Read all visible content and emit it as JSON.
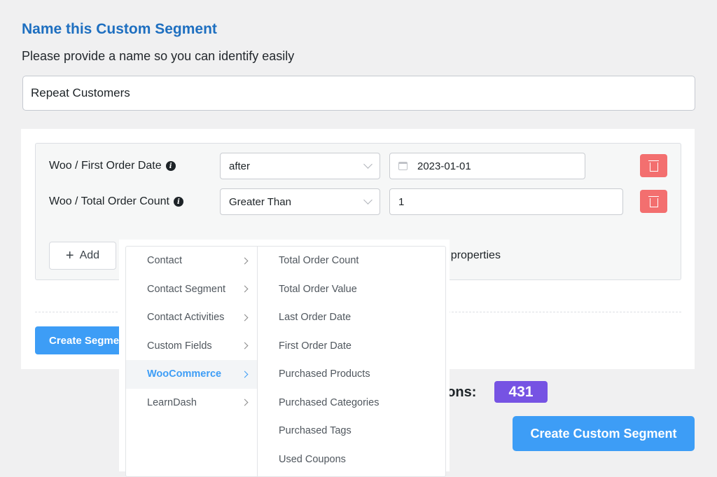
{
  "header": {
    "title": "Name this Custom Segment",
    "subtitle": "Please provide a name so you can identify easily"
  },
  "name_input": {
    "value": "Repeat Customers"
  },
  "rules": [
    {
      "label": "Woo / First Order Date",
      "operator": "after",
      "value": "2023-01-01",
      "value_icon": "calendar-icon"
    },
    {
      "label": "Woo / Total Order Count",
      "operator": "Greater Than",
      "value": "1"
    }
  ],
  "add_button": {
    "label": "Add"
  },
  "partial_text": {
    "properties": "nt properties",
    "selections": "tions:"
  },
  "create_segment_button": {
    "label": "Create Segme"
  },
  "selection_count": "431",
  "create_custom_segment_button": {
    "label": "Create Custom Segment"
  },
  "dropdown": {
    "categories": [
      {
        "label": "Contact"
      },
      {
        "label": "Contact Segment"
      },
      {
        "label": "Contact Activities"
      },
      {
        "label": "Custom Fields"
      },
      {
        "label": "WooCommerce",
        "active": true
      },
      {
        "label": "LearnDash"
      }
    ],
    "items": [
      {
        "label": "Total Order Count"
      },
      {
        "label": "Total Order Value"
      },
      {
        "label": "Last Order Date"
      },
      {
        "label": "First Order Date"
      },
      {
        "label": "Purchased Products"
      },
      {
        "label": "Purchased Categories"
      },
      {
        "label": "Purchased Tags"
      },
      {
        "label": "Used Coupons"
      }
    ]
  },
  "colors": {
    "title": "#1e6fc0",
    "primary": "#3d9df6",
    "danger": "#f36f6f",
    "badge": "#7653e3"
  }
}
